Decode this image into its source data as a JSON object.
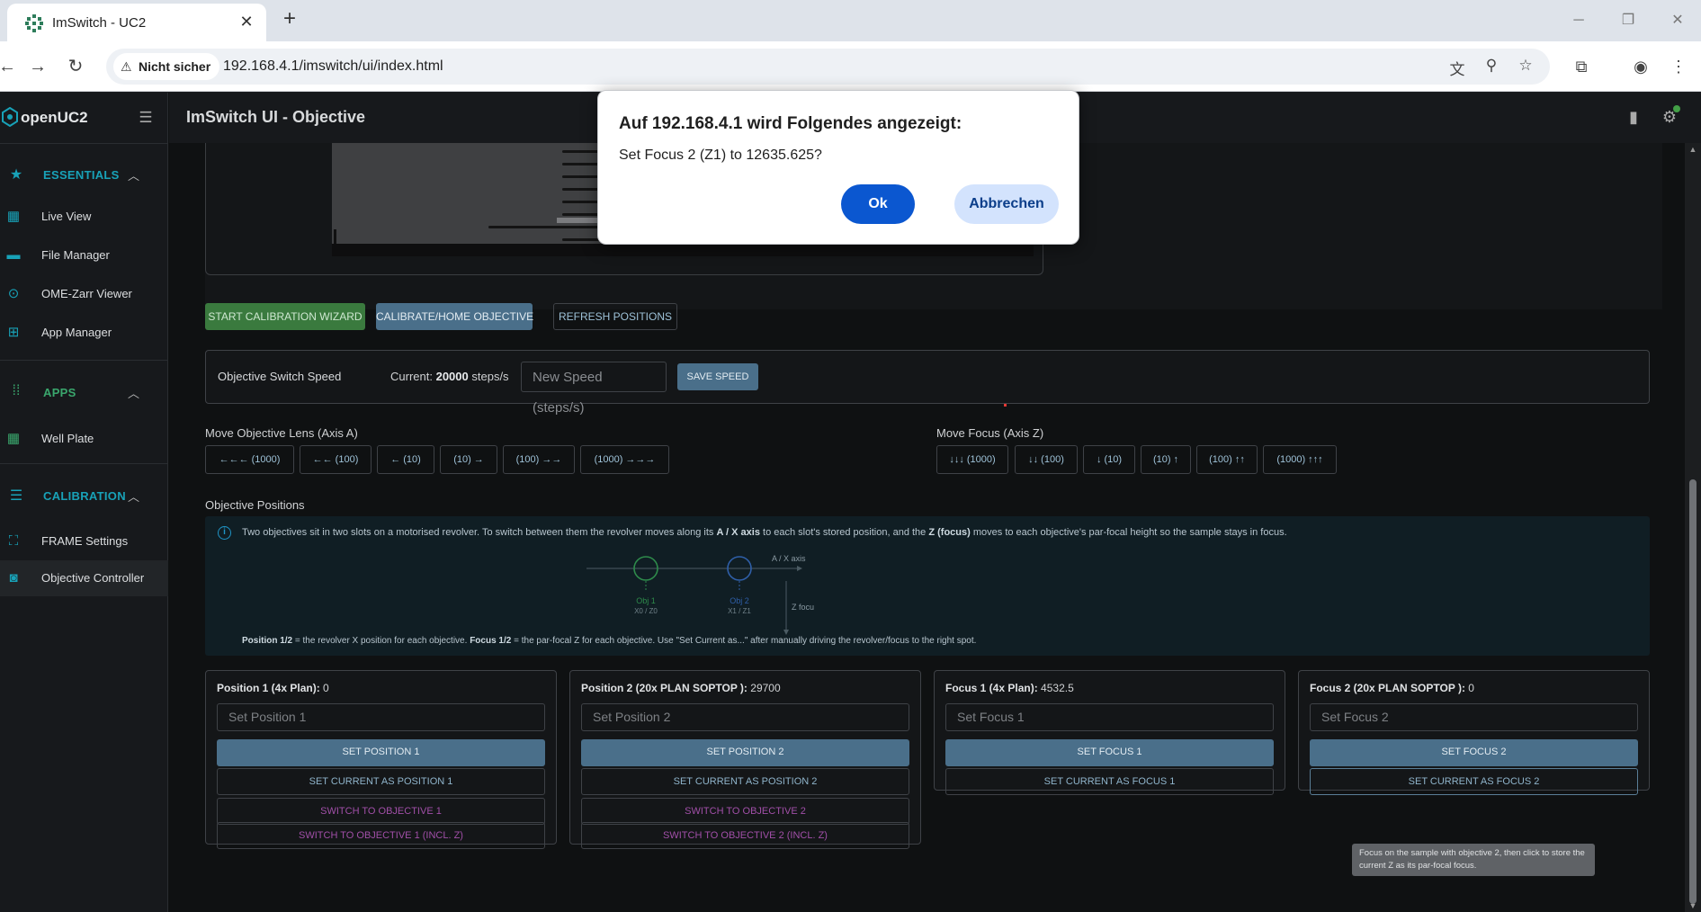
{
  "browser": {
    "tab_title": "ImSwitch - UC2",
    "security_label": "Nicht sicher",
    "url": "192.168.4.1/imswitch/ui/index.html"
  },
  "sidebar": {
    "brand": "openUC2",
    "sections": [
      {
        "label": "ESSENTIALS",
        "items": [
          "Live View",
          "File Manager",
          "OME-Zarr Viewer",
          "App Manager"
        ]
      },
      {
        "label": "APPS",
        "items": [
          "Well Plate"
        ]
      },
      {
        "label": "CALIBRATION",
        "items": [
          "FRAME Settings",
          "Objective Controller"
        ]
      }
    ],
    "active_item": "Objective Controller"
  },
  "header": {
    "title": "ImSwitch UI - Objective"
  },
  "toolbar": {
    "calibration_wizard": "START CALIBRATION WIZARD",
    "calibrate_home": "CALIBRATE/HOME OBJECTIVE",
    "refresh_positions": "REFRESH POSITIONS"
  },
  "speed": {
    "title": "Objective Switch Speed",
    "current_prefix": "Current:",
    "current_value": "20000",
    "current_unit": "steps/s",
    "input_placeholder": "New Speed (steps/s)",
    "save_label": "SAVE SPEED"
  },
  "move_objective": {
    "label": "Move Objective Lens (Axis A)",
    "buttons": [
      "←←← (1000)",
      "←← (100)",
      "← (10)",
      "(10) →",
      "(100) →→",
      "(1000) →→→"
    ]
  },
  "move_focus": {
    "label": "Move Focus (Axis Z)",
    "buttons": [
      "↓↓↓ (1000)",
      "↓↓ (100)",
      "↓ (10)",
      "(10) ↑",
      "(100) ↑↑",
      "(1000) ↑↑↑"
    ]
  },
  "positions_section": {
    "title": "Objective Positions",
    "info_pre": "Two objectives sit in two slots on a motorised revolver. To switch between them the revolver moves along its",
    "info_axis": "A / X axis",
    "info_mid": "to each slot's stored position, and the",
    "info_z": "Z (focus)",
    "info_post": "moves to each objective's par-focal height so the sample stays in focus.",
    "diagram": {
      "axis_label": "A / X axis",
      "z_label": "Z focu",
      "obj1_label": "Obj 1",
      "obj1_sub": "X0 / Z0",
      "obj2_label": "Obj 2",
      "obj2_sub": "X1 / Z1"
    },
    "note_b1": "Position 1/2",
    "note_t1": "= the revolver X position for each objective.",
    "note_b2": "Focus 1/2",
    "note_t2": "= the par-focal Z for each objective. Use \"Set Current as...\" after manually driving the revolver/focus to the right spot."
  },
  "cards": [
    {
      "title": "Position 1 (4x Plan):",
      "value": "0",
      "placeholder": "Set Position 1",
      "set_label": "SET POSITION 1",
      "current_label": "SET CURRENT AS POSITION 1",
      "switch_label": "SWITCH TO OBJECTIVE 1",
      "switch_z_label": "SWITCH TO OBJECTIVE 1 (INCL. Z)"
    },
    {
      "title": "Position 2 (20x PLAN SOPTOP ):",
      "value": "29700",
      "placeholder": "Set Position 2",
      "set_label": "SET POSITION 2",
      "current_label": "SET CURRENT AS POSITION 2",
      "switch_label": "SWITCH TO OBJECTIVE 2",
      "switch_z_label": "SWITCH TO OBJECTIVE 2 (INCL. Z)"
    },
    {
      "title": "Focus 1 (4x Plan):",
      "value": "4532.5",
      "placeholder": "Set Focus 1",
      "set_label": "SET FOCUS 1",
      "current_label": "SET CURRENT AS FOCUS 1"
    },
    {
      "title": "Focus 2 (20x PLAN SOPTOP ):",
      "value": "0",
      "placeholder": "Set Focus 2",
      "set_label": "SET FOCUS 2",
      "current_label": "SET CURRENT AS FOCUS 2"
    }
  ],
  "tooltip": "Focus on the sample with objective 2, then click to store the current Z as its par-focal focus.",
  "dialog": {
    "title": "Auf 192.168.4.1 wird Folgendes angezeigt:",
    "message": "Set Focus 2 (Z1) to 12635.625?",
    "ok_label": "Ok",
    "cancel_label": "Abbrechen"
  },
  "colors": {
    "accent": "#18a2b8",
    "primary_button": "#4a6f8a",
    "wizard_button": "#3a7a3e",
    "dialog_ok": "#0b57d0"
  }
}
